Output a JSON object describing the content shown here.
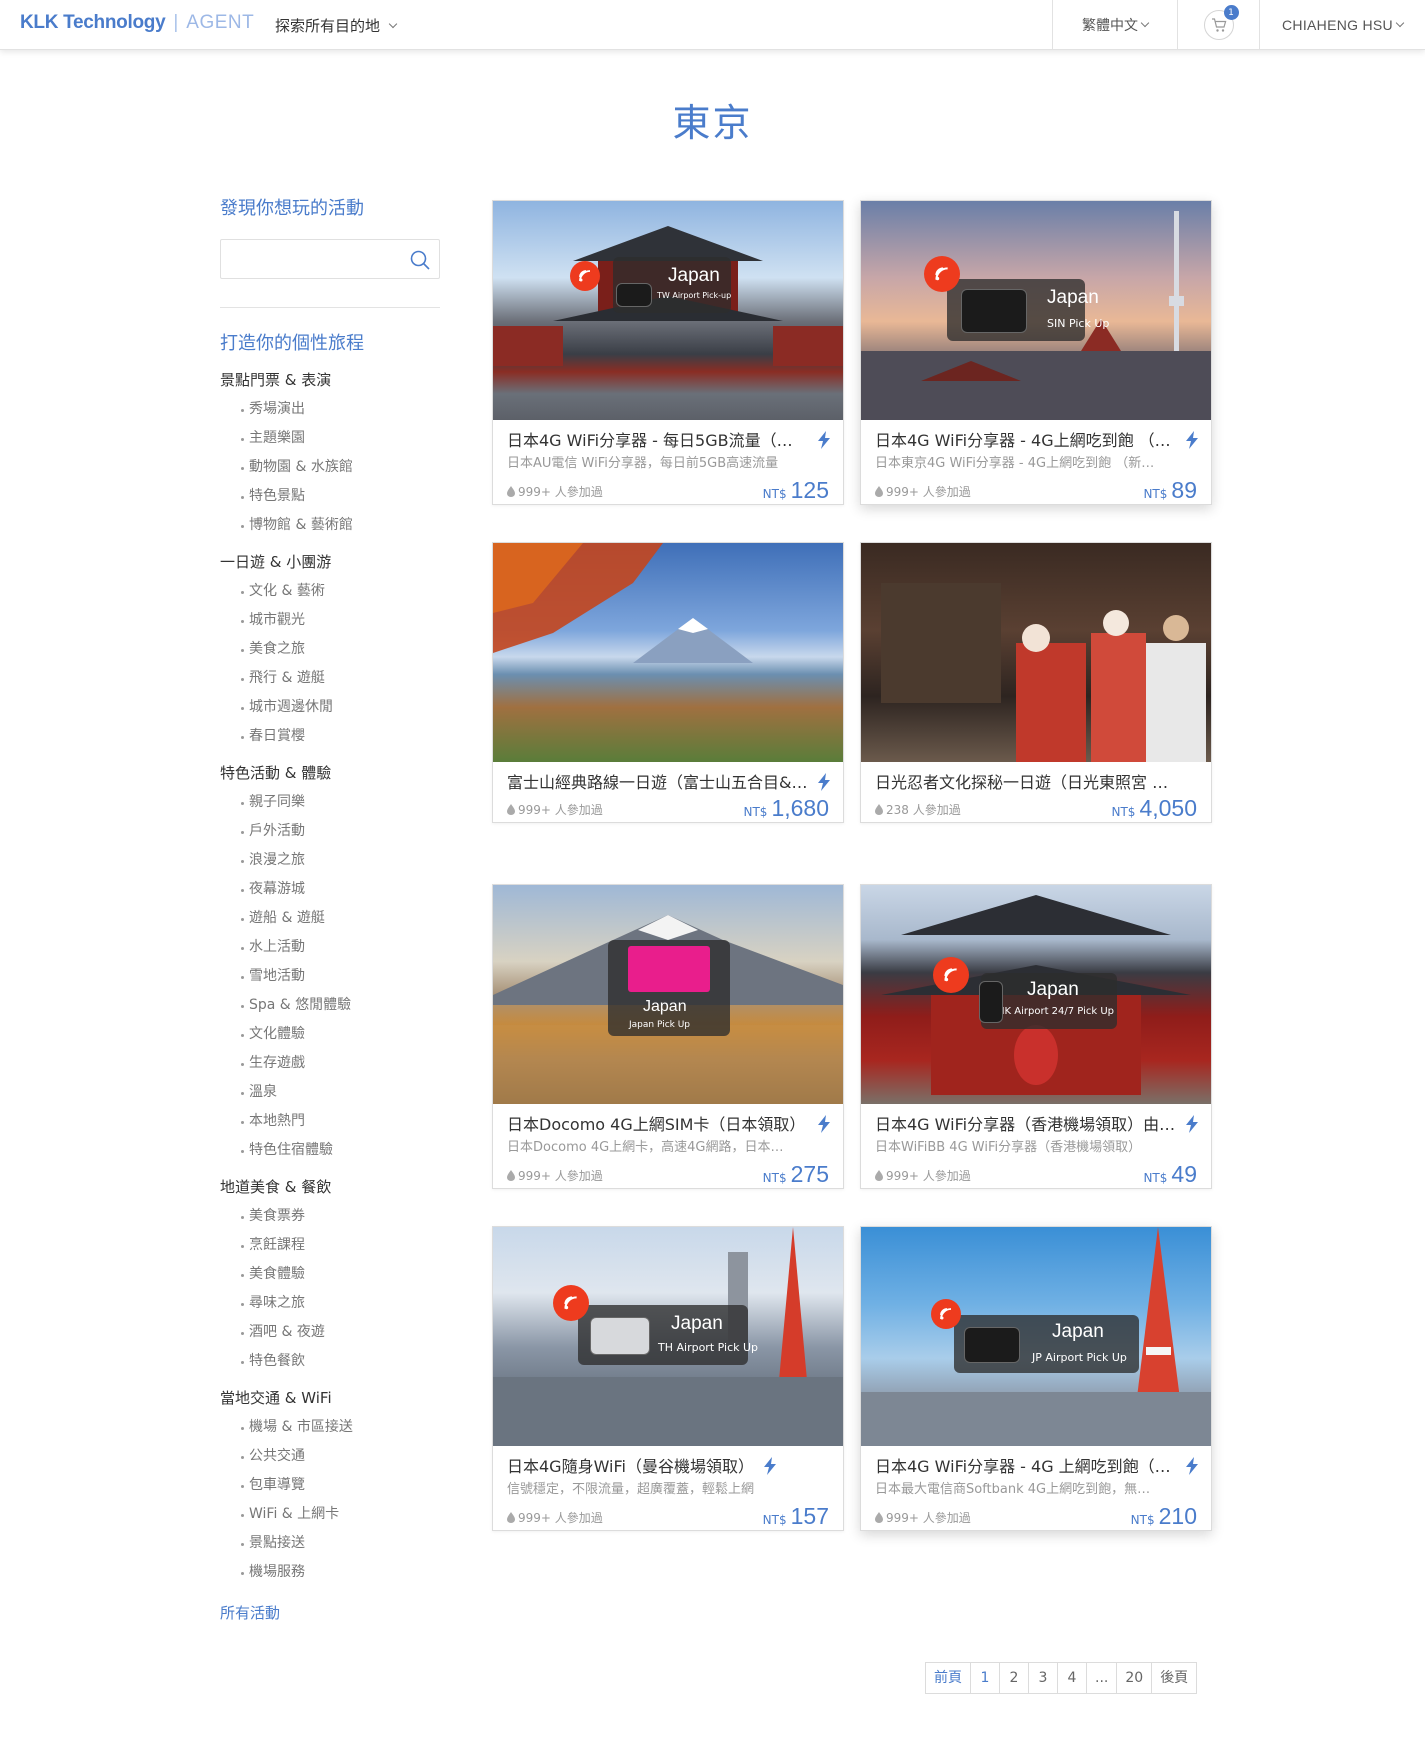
{
  "header": {
    "brand": "KLK Technology",
    "separator": "|",
    "product": "AGENT",
    "explore": "探索所有目的地",
    "language": "繁體中文",
    "cart_count": "1",
    "user": "CHIAHENG HSU"
  },
  "page_title": "東京",
  "sidebar": {
    "discover_heading": "發現你想玩的活動",
    "search_placeholder": "",
    "build_heading": "打造你的個性旅程",
    "categories": [
      {
        "title": "景點門票 & 表演",
        "items": [
          "秀場演出",
          "主題樂園",
          "動物園 & 水族館",
          "特色景點",
          "博物館 & 藝術館"
        ]
      },
      {
        "title": "一日遊 & 小團游",
        "items": [
          "文化 & 藝術",
          "城市觀光",
          "美食之旅",
          "飛行 & 遊艇",
          "城市週邊休閒",
          "春日賞櫻"
        ]
      },
      {
        "title": "特色活動 & 體驗",
        "items": [
          "親子同樂",
          "戶外活動",
          "浪漫之旅",
          "夜幕游城",
          "遊船 & 遊艇",
          "水上活動",
          "雪地活動",
          "Spa & 悠閒體驗",
          "文化體驗",
          "生存遊戲",
          "溫泉",
          "本地熱門",
          "特色住宿體驗"
        ]
      },
      {
        "title": "地道美食 & 餐飲",
        "items": [
          "美食票券",
          "烹飪課程",
          "美食體驗",
          "尋味之旅",
          "酒吧 & 夜遊",
          "特色餐飲"
        ]
      },
      {
        "title": "當地交通 & WiFi",
        "items": [
          "機場 & 市區接送",
          "公共交通",
          "包車導覽",
          "WiFi & 上網卡",
          "景點接送",
          "機場服務"
        ]
      }
    ],
    "all_activities": "所有活動"
  },
  "cards": [
    {
      "title": "日本4G WiFi分享器 - 每日5GB流量（…",
      "subtitle": "日本AU電信 WiFi分享器，每日前5GB高速流量",
      "participants": "999+ 人參加過",
      "currency": "NT$",
      "price": "125",
      "overlay_title": "Japan",
      "overlay_sub": "TW Airport Pick-up"
    },
    {
      "title": "日本4G WiFi分享器 - 4G上網吃到飽 （…",
      "subtitle": "日本東京4G WiFi分享器 - 4G上網吃到飽 （新…",
      "participants": "999+ 人參加過",
      "currency": "NT$",
      "price": "89",
      "overlay_title": "Japan",
      "overlay_sub": "SIN Pick Up"
    },
    {
      "title": "富士山經典路線一日遊（富士山五合目&…",
      "subtitle": "",
      "participants": "999+ 人參加過",
      "currency": "NT$",
      "price": "1,680"
    },
    {
      "title": "日光忍者文化探秘一日遊（日光東照宮 …",
      "subtitle": "",
      "participants": "238 人參加過",
      "currency": "NT$",
      "price": "4,050"
    },
    {
      "title": "日本Docomo 4G上網SIM卡（日本領取）",
      "subtitle": "日本Docomo 4G上網卡，高速4G網路，日本…",
      "participants": "999+ 人參加過",
      "currency": "NT$",
      "price": "275",
      "overlay_title": "Japan",
      "overlay_sub": "Japan Pick Up"
    },
    {
      "title": "日本4G WiFi分享器（香港機場領取）由…",
      "subtitle": "日本WiFiBB 4G WiFi分享器（香港機場領取）",
      "participants": "999+ 人參加過",
      "currency": "NT$",
      "price": "49",
      "overlay_title": "Japan",
      "overlay_sub": "HK Airport 24/7 Pick Up"
    },
    {
      "title": "日本4G隨身WiFi（曼谷機場領取）",
      "subtitle": "信號穩定，不限流量，超廣覆蓋，輕鬆上網",
      "participants": "999+ 人參加過",
      "currency": "NT$",
      "price": "157",
      "overlay_title": "Japan",
      "overlay_sub": "TH Airport Pick Up"
    },
    {
      "title": "日本4G WiFi分享器 - 4G 上網吃到飽（…",
      "subtitle": "日本最大電信商Softbank 4G上網吃到飽，無…",
      "participants": "999+ 人參加過",
      "currency": "NT$",
      "price": "210",
      "overlay_title": "Japan",
      "overlay_sub": "JP Airport Pick Up"
    }
  ],
  "pagination": {
    "prev": "前頁",
    "pages": [
      "1",
      "2",
      "3",
      "4",
      "...",
      "20"
    ],
    "next": "後頁"
  },
  "colors": {
    "accent": "#4a7ccb",
    "wifi_badge": "#ee3b1e"
  }
}
